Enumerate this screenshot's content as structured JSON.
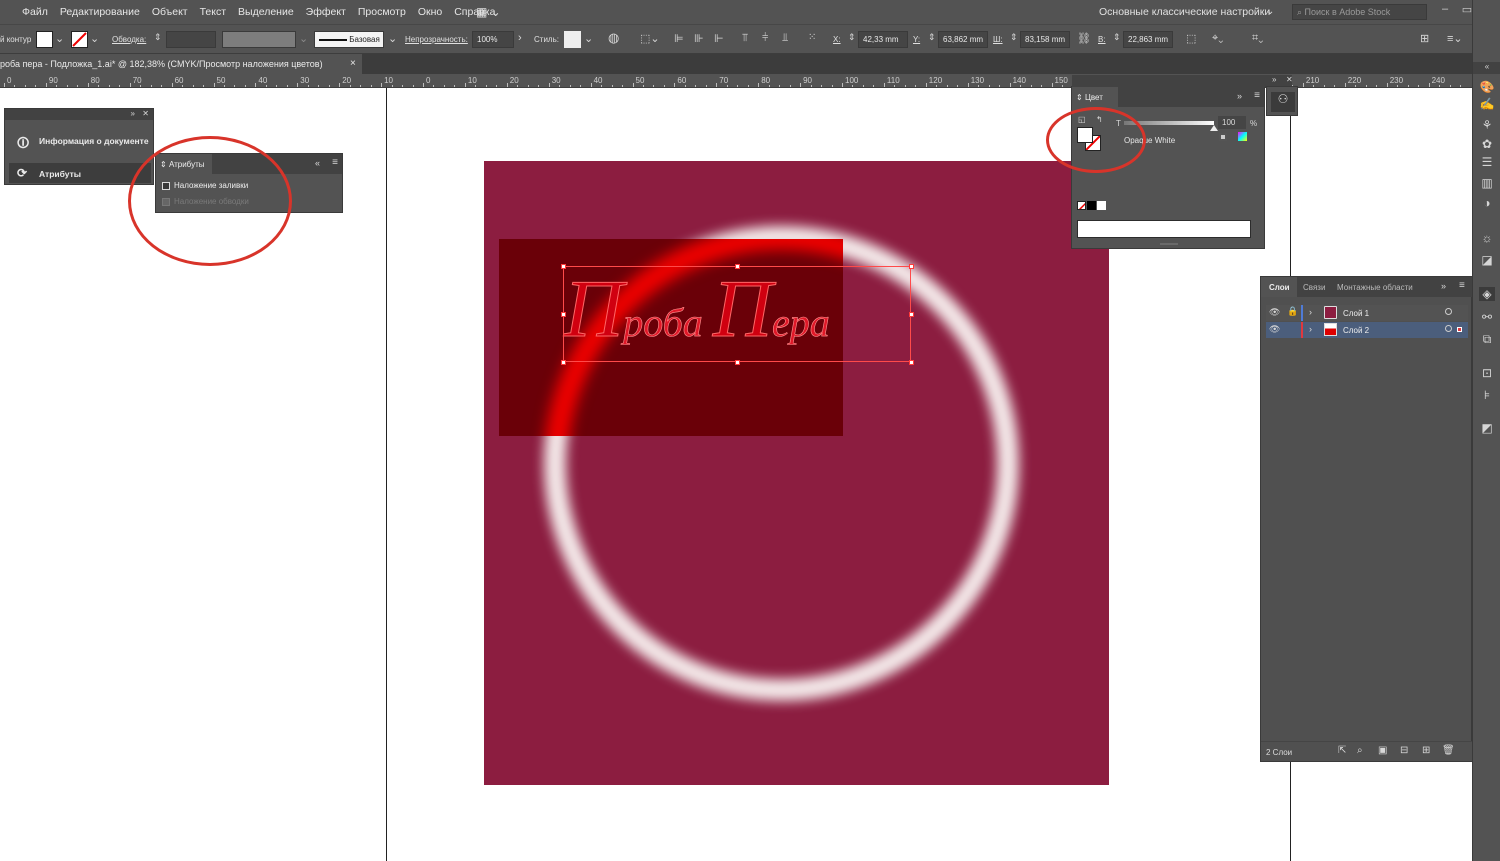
{
  "menubar": {
    "items": [
      "Файл",
      "Редактирование",
      "Объект",
      "Текст",
      "Выделение",
      "Эффект",
      "Просмотр",
      "Окно",
      "Справка"
    ],
    "workspace": "Основные классические настройки",
    "search_placeholder": "Поиск в Adobe Stock"
  },
  "control_bar": {
    "selection_label": "й контур",
    "stroke_label": "Обводка:",
    "brush_label": "Базовая",
    "opacity_label": "Непрозрачность:",
    "opacity_value": "100%",
    "style_label": "Стиль:",
    "x_label": "X:",
    "x_value": "42,33 mm",
    "y_label": "Y:",
    "y_value": "63,862 mm",
    "w_label": "Ш:",
    "w_value": "83,158 mm",
    "h_label": "В:",
    "h_value": "22,863 mm"
  },
  "document_tab": {
    "title": "роба пера - Подложка_1.ai* @ 182,38% (CMYK/Просмотр наложения цветов)",
    "close": "×"
  },
  "ruler": {
    "labels": [
      "0",
      "90",
      "80",
      "70",
      "60",
      "50",
      "40",
      "30",
      "20",
      "10",
      "0",
      "10",
      "20",
      "30",
      "40",
      "50",
      "60",
      "70",
      "80",
      "90",
      "100",
      "110",
      "120",
      "130",
      "140",
      "150",
      "160",
      "170",
      "180",
      "190",
      "200",
      "210",
      "220",
      "230",
      "240"
    ]
  },
  "left_dock": {
    "items": [
      "Информация о документе",
      "Атрибуты"
    ]
  },
  "attributes_panel": {
    "title": "Атрибуты",
    "overprint_fill": "Наложение заливки",
    "overprint_stroke": "Наложение обводки"
  },
  "color_panel": {
    "title": "Цвет",
    "tint_letter": "T",
    "tint_value": "100",
    "percent": "%",
    "color_name": "Opaque White"
  },
  "artwork": {
    "text_part1_big": "П",
    "text_part1_small": "роба ",
    "text_part2_big": "П",
    "text_part2_small": "ера"
  },
  "layers_panel": {
    "tabs": [
      "Слои",
      "Связи",
      "Монтажные области"
    ],
    "layers": [
      {
        "name": "Слой 1",
        "color": "#4f7bd6"
      },
      {
        "name": "Слой 2",
        "color": "#e0383e"
      }
    ],
    "footer_count": "2 Слои"
  },
  "colors": {
    "artboard_bg": "#8c1d40",
    "dark_rect": "#6a0008",
    "text_red": "#ff2020",
    "annotation_red": "#d8342a"
  }
}
